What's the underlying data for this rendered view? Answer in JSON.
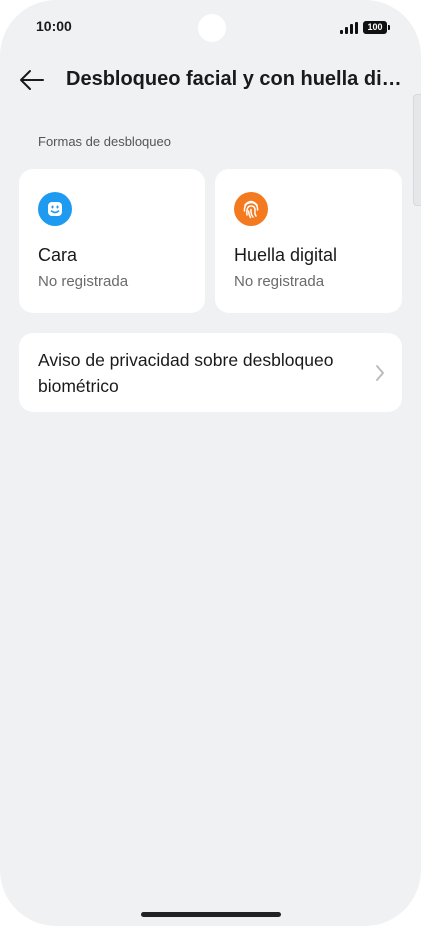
{
  "status_bar": {
    "time": "10:00",
    "battery": "100"
  },
  "header": {
    "title": "Desbloqueo facial y con huella digital",
    "back_icon": "arrow-left-icon"
  },
  "section": {
    "label": "Formas de desbloqueo"
  },
  "cards": [
    {
      "title": "Cara",
      "subtitle": "No registrada",
      "icon": "face-icon",
      "icon_color": "#1e9bf0"
    },
    {
      "title": "Huella digital",
      "subtitle": "No registrada",
      "icon": "fingerprint-icon",
      "icon_color": "#f47a1f"
    }
  ],
  "privacy": {
    "label": "Aviso de privacidad sobre desbloqueo biométrico",
    "chevron_icon": "chevron-right-icon"
  },
  "colors": {
    "background": "#f0f1f3",
    "card": "#ffffff",
    "face_accent": "#1e9bf0",
    "fingerprint_accent": "#f47a1f"
  }
}
